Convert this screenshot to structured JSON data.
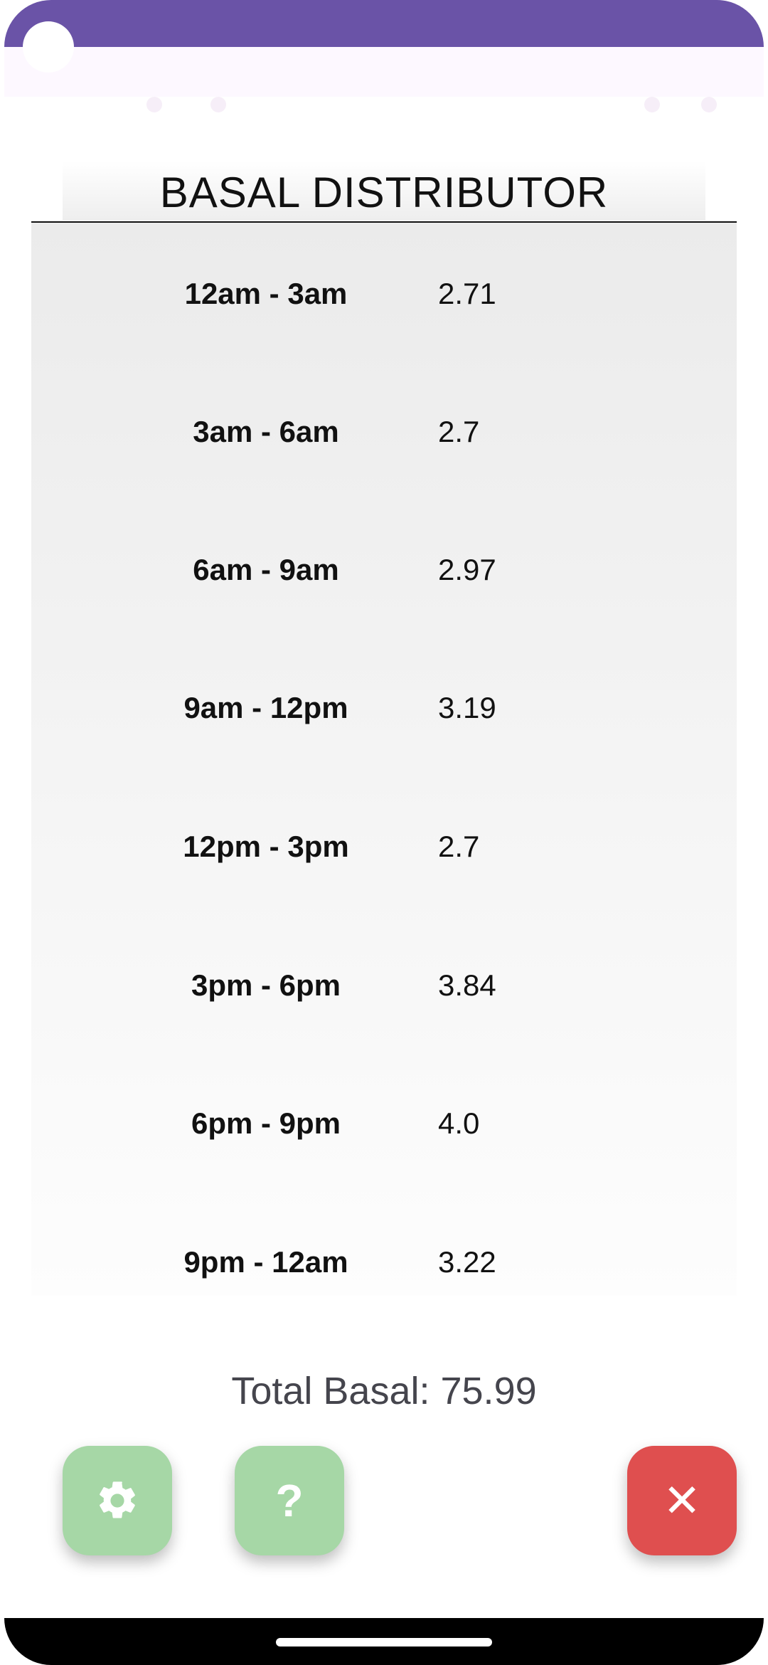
{
  "app": {
    "accent_color": "#6a53a7",
    "title": "BASAL DISTRIBUTOR"
  },
  "basal_table": {
    "rows": [
      {
        "label": "12am - 3am",
        "value": "2.71"
      },
      {
        "label": "3am - 6am",
        "value": "2.7"
      },
      {
        "label": "6am - 9am",
        "value": "2.97"
      },
      {
        "label": "9am - 12pm",
        "value": "3.19"
      },
      {
        "label": "12pm - 3pm",
        "value": "2.7"
      },
      {
        "label": "3pm - 6pm",
        "value": "3.84"
      },
      {
        "label": "6pm - 9pm",
        "value": "4.0"
      },
      {
        "label": "9pm - 12am",
        "value": "3.22"
      }
    ]
  },
  "total": {
    "text": "Total Basal: 75.99"
  },
  "actions": {
    "settings_icon": "gear-icon",
    "help_icon": "question-icon",
    "help_glyph": "?",
    "close_icon": "close-icon",
    "close_glyph": "✕",
    "settings_color": "#a6d7a6",
    "help_color": "#a6d7a6",
    "close_color": "#df4f4f"
  }
}
